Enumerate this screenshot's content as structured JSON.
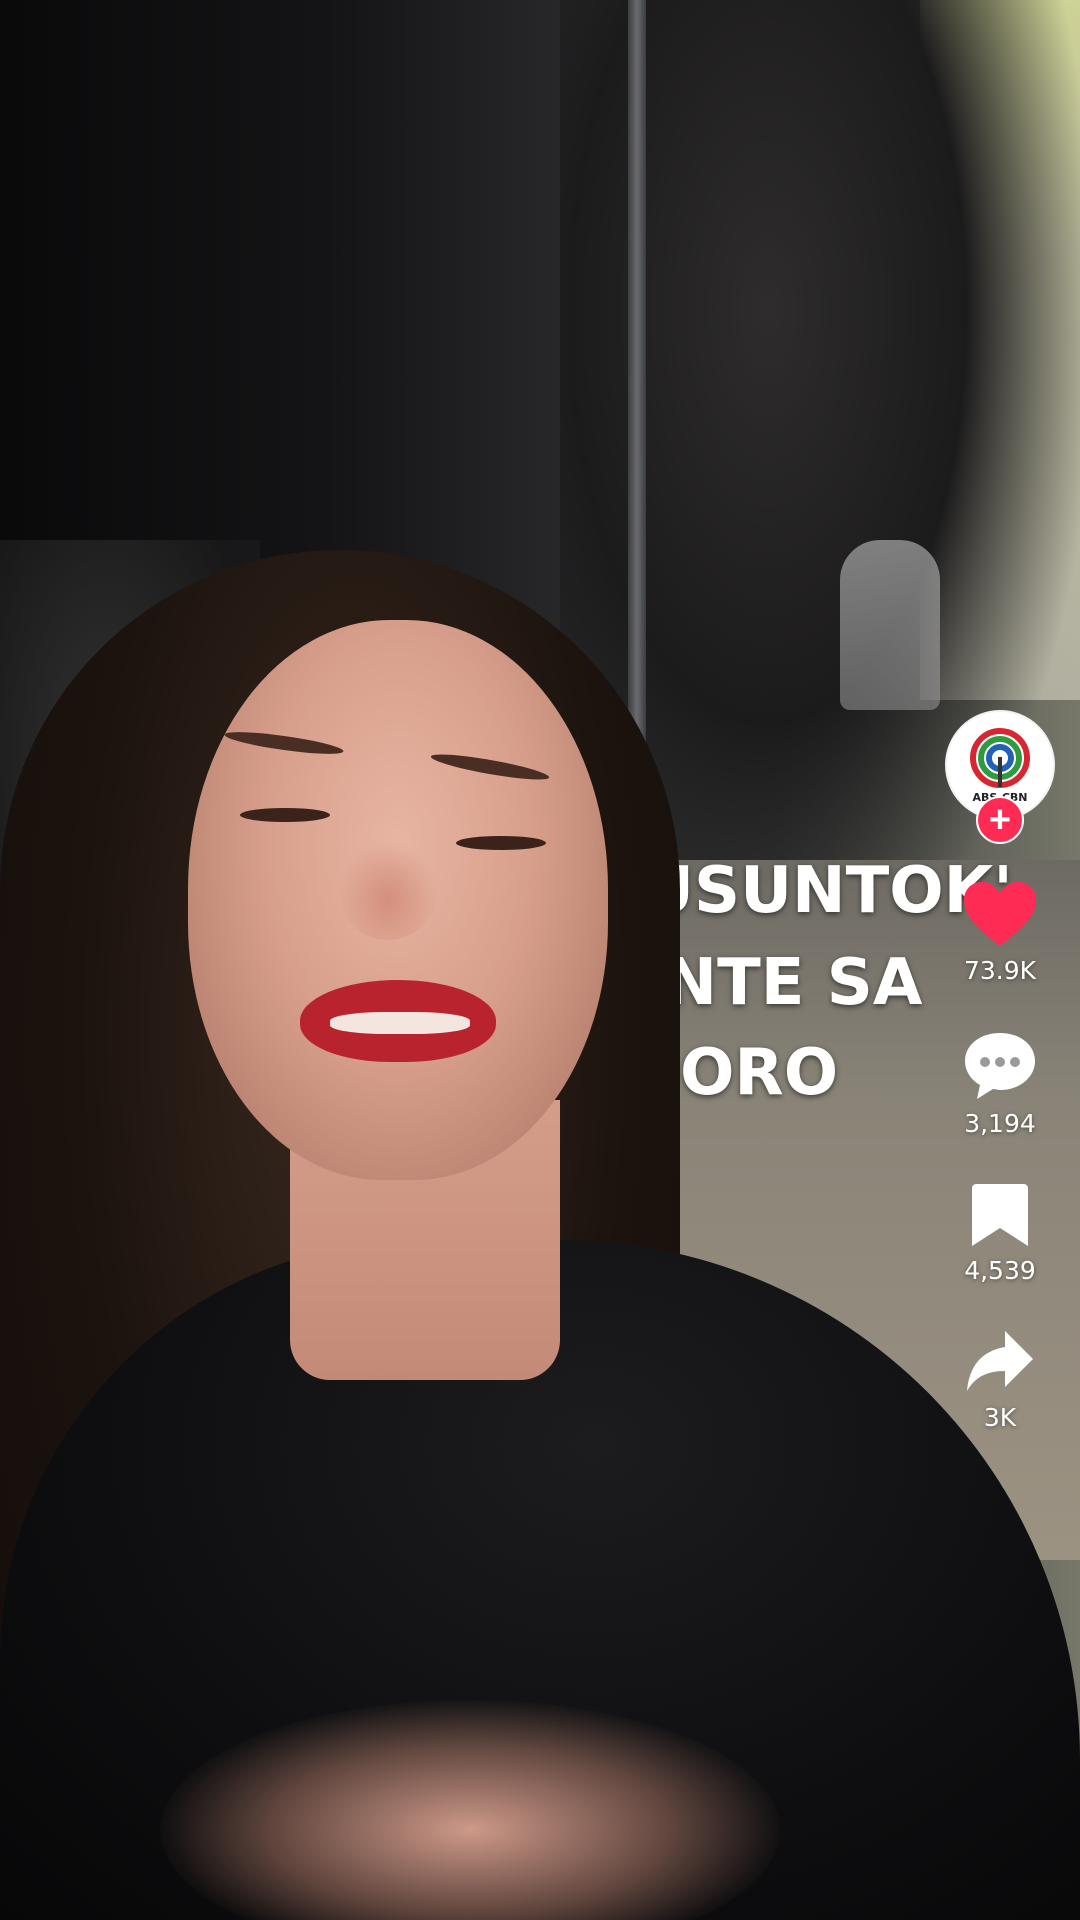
{
  "video": {
    "overlay_count": "26",
    "caption_lines": [
      "USUNTOK'",
      "ANTE SA",
      "E ORO"
    ]
  },
  "creator": {
    "avatar_label": "ABS-CBN",
    "follow_symbol": "+"
  },
  "actions": {
    "like_count": "73.9K",
    "comment_count": "3,194",
    "save_count": "4,539",
    "share_count": "3K"
  },
  "colors": {
    "like": "#fe2c55",
    "follow": "#fe2c55",
    "icon": "#ffffff"
  },
  "icons": {
    "like": "heart-icon",
    "comment": "comment-bubble-icon",
    "save": "bookmark-icon",
    "share": "share-arrow-icon"
  }
}
